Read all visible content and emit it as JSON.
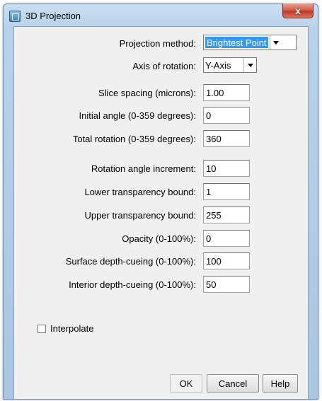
{
  "window": {
    "title": "3D Projection",
    "close_glyph": "x",
    "icon": "app-icon"
  },
  "fields": [
    {
      "label": "Projection method:",
      "type": "select",
      "value": "Brightest Point",
      "highlighted": true
    },
    {
      "label": "Axis of rotation:",
      "type": "select",
      "value": "Y-Axis"
    },
    {
      "label": "Slice spacing (microns):",
      "type": "text",
      "value": "1.00"
    },
    {
      "label": "Initial angle (0-359 degrees):",
      "type": "text",
      "value": "0"
    },
    {
      "label": "Total rotation (0-359 degrees):",
      "type": "text",
      "value": "360"
    },
    {
      "label": "Rotation angle increment:",
      "type": "text",
      "value": "10"
    },
    {
      "label": "Lower transparency bound:",
      "type": "text",
      "value": "1"
    },
    {
      "label": "Upper transparency bound:",
      "type": "text",
      "value": "255"
    },
    {
      "label": "Opacity (0-100%):",
      "type": "text",
      "value": "0"
    },
    {
      "label": "Surface depth-cueing (0-100%):",
      "type": "text",
      "value": "100"
    },
    {
      "label": "Interior depth-cueing (0-100%):",
      "type": "text",
      "value": "50"
    }
  ],
  "interpolate": {
    "label": "Interpolate",
    "checked": false
  },
  "buttons": {
    "ok": "OK",
    "cancel": "Cancel",
    "help": "Help"
  },
  "colors": {
    "selection": "#3399ff",
    "close_button": "#c0392b",
    "frame": "#b8d2ea"
  }
}
